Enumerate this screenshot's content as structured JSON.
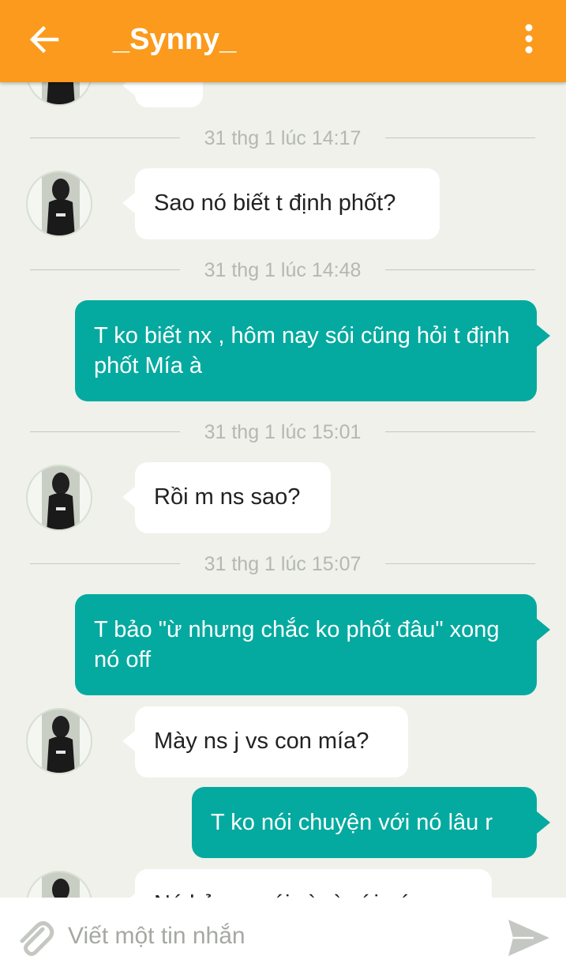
{
  "header": {
    "title": "_Synny_",
    "back_icon": "arrow-left-icon",
    "menu_icon": "more-vert-icon",
    "color": "#fb9a1c"
  },
  "messages": [
    {
      "kind": "incoming",
      "text": ""
    },
    {
      "kind": "timestamp",
      "text": "31 thg 1 lúc 14:17"
    },
    {
      "kind": "incoming",
      "text": "Sao nó biết t định phốt?"
    },
    {
      "kind": "timestamp",
      "text": "31 thg 1 lúc 14:48"
    },
    {
      "kind": "outgoing",
      "text": "T ko biết nx , hôm nay sói cũng hỏi t định phốt Mía à"
    },
    {
      "kind": "timestamp",
      "text": "31 thg 1 lúc 15:01"
    },
    {
      "kind": "incoming",
      "text": "Rồi m ns sao?"
    },
    {
      "kind": "timestamp",
      "text": "31 thg 1 lúc 15:07"
    },
    {
      "kind": "outgoing",
      "text": "T bảo \"ừ nhưng chắc ko phốt đâu\" xong nó off"
    },
    {
      "kind": "incoming",
      "text": "Mày ns j vs con mía?"
    },
    {
      "kind": "outgoing",
      "text": "T ko nói chuyện với nó lâu r"
    },
    {
      "kind": "incoming",
      "text": "Nó bảo m nói gì gì với nó"
    }
  ],
  "composer": {
    "placeholder": "Viết một tin nhắn",
    "attach_icon": "paperclip-icon",
    "send_icon": "send-icon"
  },
  "colors": {
    "outgoing_bubble": "#04aa9f",
    "incoming_bubble": "#ffffff",
    "background": "#eff1ea"
  }
}
